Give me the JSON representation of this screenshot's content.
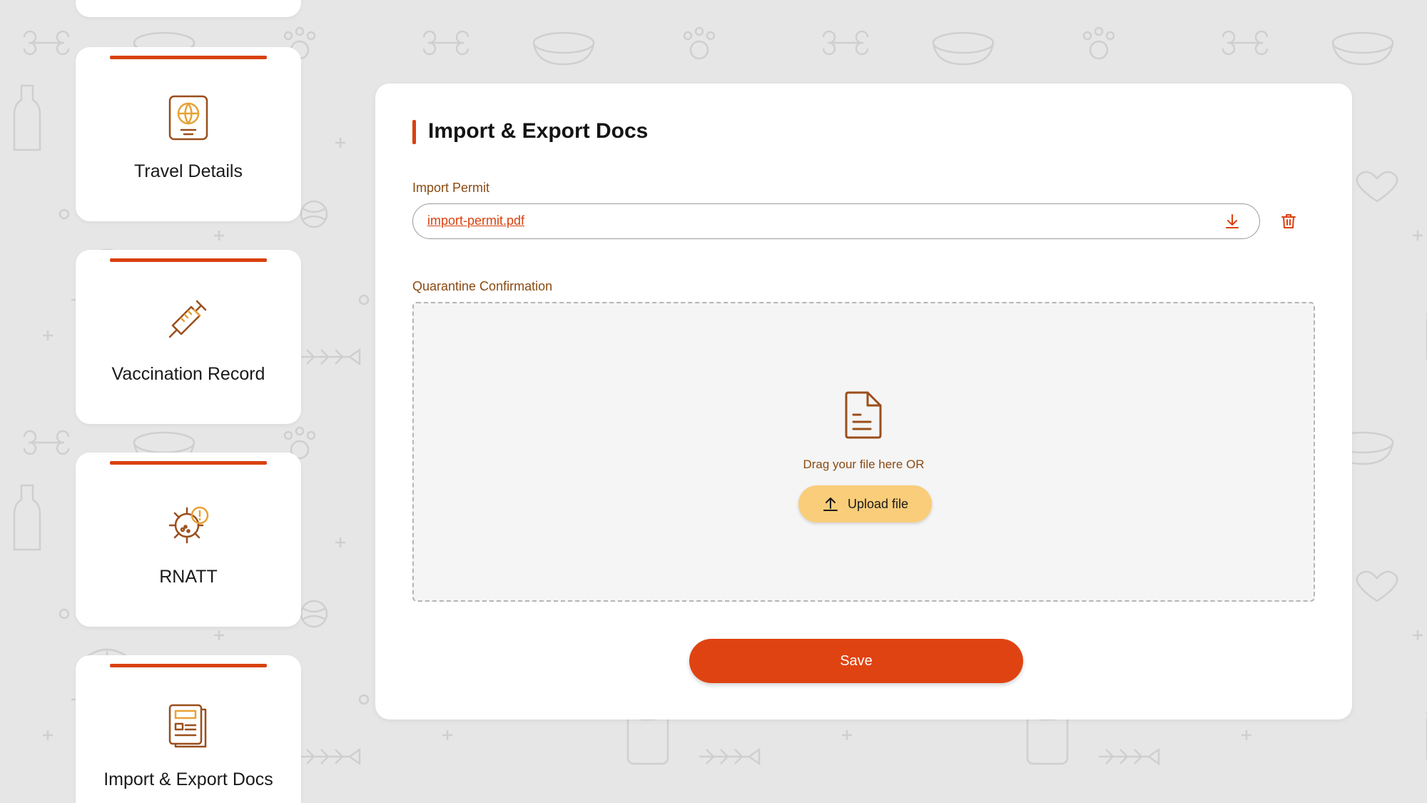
{
  "colors": {
    "accent": "#d9410e",
    "label": "#8a4a12",
    "icon": "#9a4e1c",
    "upload_button": "#f9cd79",
    "save_button": "#e04312",
    "background": "#e6e6e6"
  },
  "sidebar": {
    "items": [
      {
        "label": "Travel Details",
        "icon": "passport-icon"
      },
      {
        "label": "Vaccination Record",
        "icon": "syringe-icon"
      },
      {
        "label": "RNATT",
        "icon": "virus-warning-icon"
      },
      {
        "label": "Import & Export Docs",
        "icon": "documents-icon"
      }
    ]
  },
  "panel": {
    "title": "Import & Export Docs",
    "import_permit": {
      "label": "Import Permit",
      "file_name": "import-permit.pdf"
    },
    "quarantine": {
      "label": "Quarantine Confirmation",
      "drag_text": "Drag your file here OR",
      "upload_label": "Upload file"
    },
    "save_label": "Save"
  }
}
